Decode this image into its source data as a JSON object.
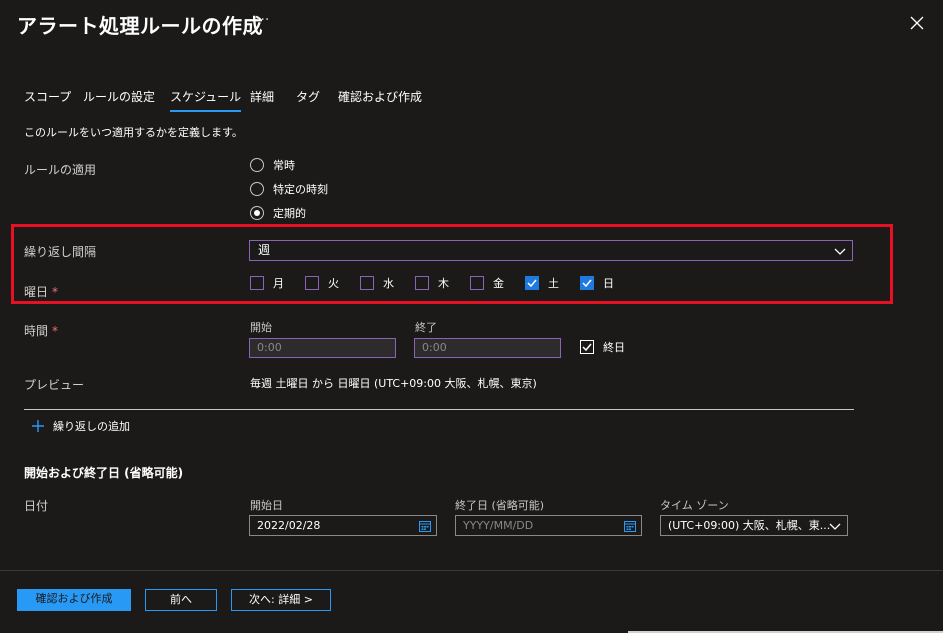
{
  "header": {
    "title": "アラート処理ルールの作成",
    "more": "···"
  },
  "tabs": [
    "スコープ",
    "ルールの設定",
    "スケジュール",
    "詳細",
    "タグ",
    "確認および作成"
  ],
  "description": "このルールをいつ適用するかを定義します。",
  "apply": {
    "label": "ルールの適用",
    "options": [
      "常時",
      "特定の時刻",
      "定期的"
    ],
    "selected": "定期的"
  },
  "recurrence": {
    "label": "繰り返し間隔",
    "value": "週"
  },
  "weekdays": {
    "label": "曜日",
    "required": "*",
    "days": [
      {
        "label": "月",
        "checked": false
      },
      {
        "label": "火",
        "checked": false
      },
      {
        "label": "水",
        "checked": false
      },
      {
        "label": "木",
        "checked": false
      },
      {
        "label": "金",
        "checked": false
      },
      {
        "label": "土",
        "checked": true
      },
      {
        "label": "日",
        "checked": true
      }
    ]
  },
  "time": {
    "label": "時間",
    "required": "*",
    "start_label": "開始",
    "start_placeholder": "0:00",
    "end_label": "終了",
    "end_placeholder": "0:00",
    "allday_label": "終日",
    "allday_checked": true
  },
  "preview": {
    "label": "プレビュー",
    "text": "毎週 土曜日 から 日曜日 (UTC+09:00 大阪、札幌、東京)"
  },
  "add_recurrence": "繰り返しの追加",
  "dates": {
    "section_title": "開始および終了日 (省略可能)",
    "label": "日付",
    "start_label": "開始日",
    "start_value": "2022/02/28",
    "end_label": "終了日 (省略可能)",
    "end_placeholder": "YYYY/MM/DD",
    "tz_label": "タイム ゾーン",
    "tz_value": "(UTC+09:00) 大阪、札幌、東..."
  },
  "footer": {
    "review": "確認および作成",
    "prev": "前へ",
    "next": "次へ: 詳細 >"
  },
  "colors": {
    "accent": "#2899f5",
    "focus": "#8764b8",
    "highlight": "#e81123",
    "background": "#1b1a19"
  }
}
